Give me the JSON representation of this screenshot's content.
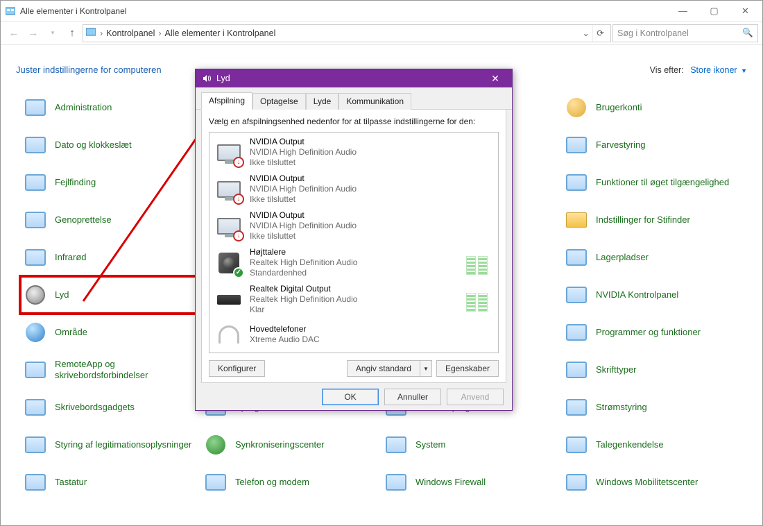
{
  "explorer": {
    "title": "Alle elementer i Kontrolpanel",
    "breadcrumb": [
      "Kontrolpanel",
      "Alle elementer i Kontrolpanel"
    ],
    "search_placeholder": "Søg i Kontrolpanel",
    "heading": "Juster indstillingerne for computeren",
    "view_by_label": "Vis efter:",
    "view_by_value": "Store ikoner"
  },
  "cp_items": [
    {
      "label": "Administration",
      "icon": "admin"
    },
    {
      "label": "Brugerkonti",
      "icon": "users"
    },
    {
      "label": "Dato og klokkeslæt",
      "icon": "clock"
    },
    {
      "label": "Farvestyring",
      "icon": "color"
    },
    {
      "label": "Fejlfinding",
      "icon": "trouble"
    },
    {
      "label": "Funktioner til øget tilgængelighed",
      "icon": "access"
    },
    {
      "label": "Genoprettelse",
      "icon": "recovery"
    },
    {
      "label": "Indstillinger for Stifinder",
      "icon": "folder"
    },
    {
      "label": "Infrarød",
      "icon": "ir"
    },
    {
      "label": "Lagerpladser",
      "icon": "storage"
    },
    {
      "label": "Lyd",
      "icon": "speaker",
      "highlight": true
    },
    {
      "label": "NVIDIA Kontrolpanel",
      "icon": "nvidia"
    },
    {
      "label": "Område",
      "icon": "region"
    },
    {
      "label": "Programmer og funktioner",
      "icon": "programs"
    },
    {
      "label": "RemoteApp og skrivebordsforbindelser",
      "icon": "remote"
    },
    {
      "label": "Skrifttyper",
      "icon": "fonts"
    },
    {
      "label": "Skrivebordsgadgets",
      "icon": "gadgets"
    },
    {
      "label": "Sprog",
      "icon": "lang"
    },
    {
      "label": "Standardprogrammer",
      "icon": "defaults"
    },
    {
      "label": "Strømstyring",
      "icon": "power"
    },
    {
      "label": "Styring af legitimationsoplysninger",
      "icon": "cred"
    },
    {
      "label": "Synkroniseringscenter",
      "icon": "sync"
    },
    {
      "label": "System",
      "icon": "system"
    },
    {
      "label": "Talegenkendelse",
      "icon": "speech"
    },
    {
      "label": "Tastatur",
      "icon": "kb"
    },
    {
      "label": "Telefon og modem",
      "icon": "phone"
    },
    {
      "label": "Windows Firewall",
      "icon": "fw"
    },
    {
      "label": "Windows Mobilitetscenter",
      "icon": "mob"
    }
  ],
  "cp_layout": [
    [
      0,
      null,
      null,
      1
    ],
    [
      2,
      null,
      null,
      3
    ],
    [
      4,
      null,
      null,
      5
    ],
    [
      6,
      null,
      null,
      7
    ],
    [
      8,
      null,
      null,
      9
    ],
    [
      10,
      null,
      null,
      11
    ],
    [
      12,
      null,
      null,
      13
    ],
    [
      14,
      null,
      null,
      15
    ],
    [
      16,
      17,
      18,
      19
    ],
    [
      20,
      21,
      22,
      23
    ],
    [
      24,
      25,
      26,
      27
    ]
  ],
  "dialog": {
    "title": "Lyd",
    "tabs": [
      "Afspilning",
      "Optagelse",
      "Lyde",
      "Kommunikation"
    ],
    "active_tab": 0,
    "instruction": "Vælg en afspilningsenhed nedenfor for at tilpasse indstillingerne for den:",
    "devices": [
      {
        "name": "NVIDIA Output",
        "sub": "NVIDIA High Definition Audio",
        "status": "Ikke tilsluttet",
        "type": "monitor",
        "badge": "down"
      },
      {
        "name": "NVIDIA Output",
        "sub": "NVIDIA High Definition Audio",
        "status": "Ikke tilsluttet",
        "type": "monitor",
        "badge": "down"
      },
      {
        "name": "NVIDIA Output",
        "sub": "NVIDIA High Definition Audio",
        "status": "Ikke tilsluttet",
        "type": "monitor",
        "badge": "down"
      },
      {
        "name": "Højttalere",
        "sub": "Realtek High Definition Audio",
        "status": "Standardenhed",
        "type": "speaker",
        "badge": "ok",
        "level": true
      },
      {
        "name": "Realtek Digital Output",
        "sub": "Realtek High Definition Audio",
        "status": "Klar",
        "type": "box",
        "level": true
      },
      {
        "name": "Hovedtelefoner",
        "sub": "Xtreme Audio DAC",
        "status": "",
        "type": "hp"
      }
    ],
    "buttons": {
      "configure": "Konfigurer",
      "set_default": "Angiv standard",
      "properties": "Egenskaber",
      "ok": "OK",
      "cancel": "Annuller",
      "apply": "Anvend"
    }
  }
}
